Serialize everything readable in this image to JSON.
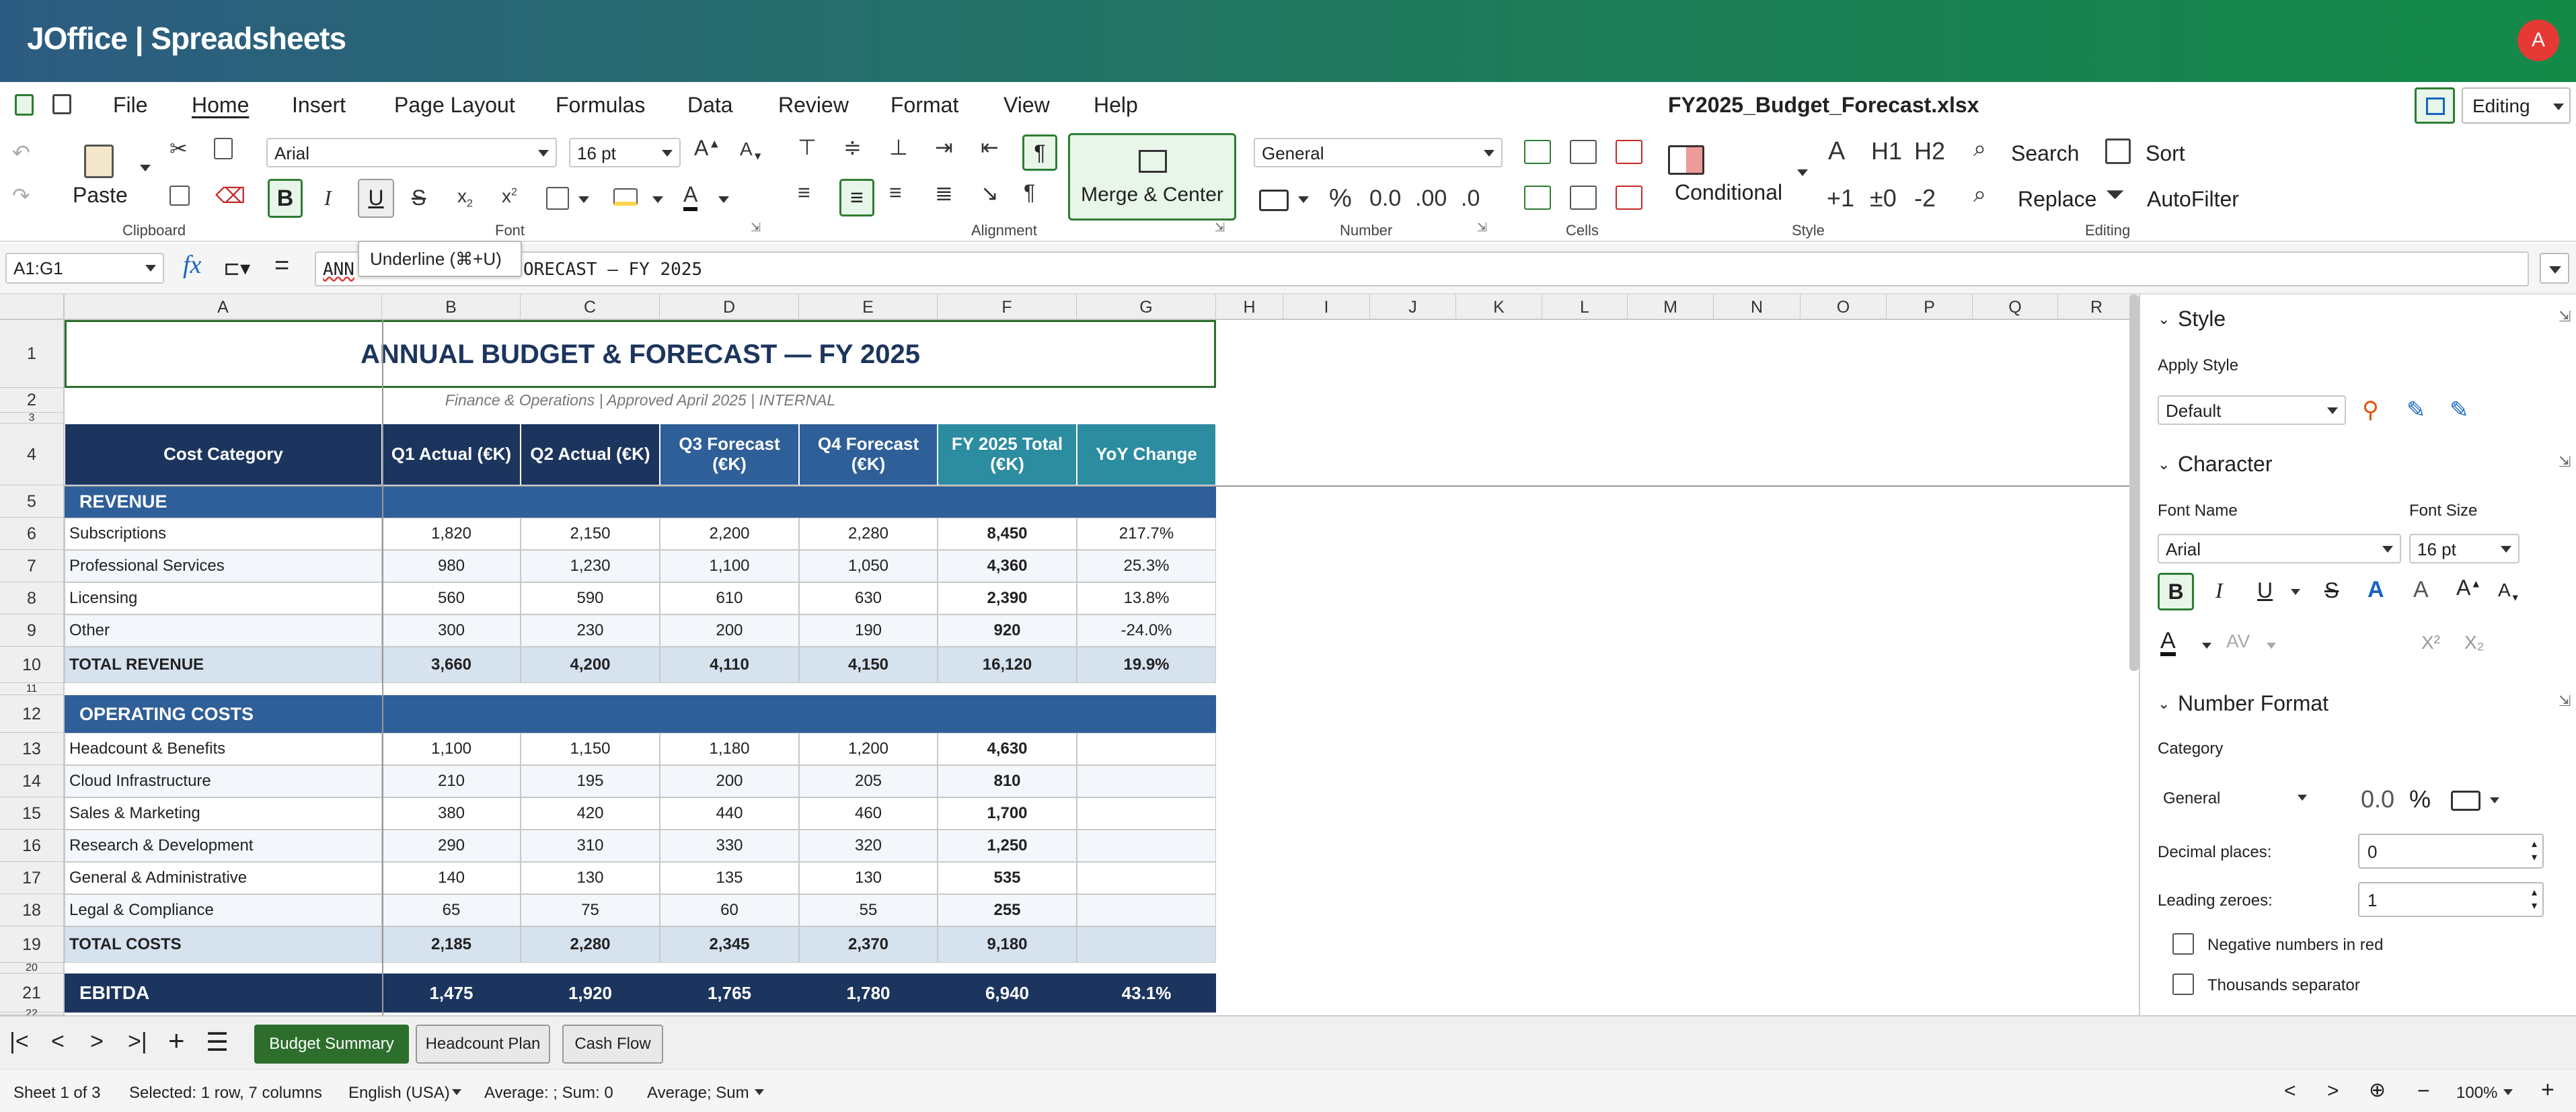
{
  "app": {
    "title": "JOffice | Spreadsheets",
    "avatar_letter": "A"
  },
  "menu": {
    "items": [
      "File",
      "Home",
      "Insert",
      "Page Layout",
      "Formulas",
      "Data",
      "Review",
      "Format",
      "View",
      "Help"
    ],
    "active": "Home",
    "doc_title": "FY2025_Budget_Forecast.xlsx",
    "mode": "Editing"
  },
  "ribbon": {
    "paste": "Paste",
    "font_name": "Arial",
    "font_size": "16 pt",
    "merge_center": "Merge & Center",
    "number_format": "General",
    "percent": "%",
    "decimals_a": "0.0",
    "decimals_b": ".00",
    "decimals_c": ".0",
    "conditional": "Conditional",
    "style_a": "A",
    "style_h1": "H1",
    "style_h2": "H2",
    "style_p1": "+1",
    "style_0": "±0",
    "style_m2": "-2",
    "search": "Search",
    "sort": "Sort",
    "replace": "Replace",
    "autofilter": "AutoFilter",
    "groups": {
      "clipboard": "Clipboard",
      "font": "Font",
      "alignment": "Alignment",
      "number": "Number",
      "cells": "Cells",
      "style": "Style",
      "editing": "Editing"
    }
  },
  "formula_bar": {
    "name_box": "A1:G1",
    "formula_start": "ANN",
    "formula_end": "ORECAST — FY 2025",
    "tooltip": "Underline (⌘+U)"
  },
  "columns": [
    "A",
    "B",
    "C",
    "D",
    "E",
    "F",
    "G",
    "H",
    "I",
    "J",
    "K",
    "L",
    "M",
    "N",
    "O",
    "P",
    "Q",
    "R"
  ],
  "rows": [
    "1",
    "2",
    "3",
    "4",
    "5",
    "6",
    "7",
    "8",
    "9",
    "10",
    "11",
    "12",
    "13",
    "14",
    "15",
    "16",
    "17",
    "18",
    "19",
    "20",
    "21",
    "22"
  ],
  "sheet": {
    "title": "ANNUAL BUDGET & FORECAST — FY 2025",
    "subtitle": "Finance & Operations  |  Approved April 2025  |  INTERNAL",
    "headers": [
      "Cost Category",
      "Q1 Actual (€K)",
      "Q2 Actual (€K)",
      "Q3 Forecast (€K)",
      "Q4 Forecast (€K)",
      "FY 2025 Total (€K)",
      "YoY Change"
    ],
    "revenue_section": "REVENUE",
    "revenue_rows": [
      [
        "Subscriptions",
        "1,820",
        "2,150",
        "2,200",
        "2,280",
        "8,450",
        "217.7%"
      ],
      [
        "Professional Services",
        "980",
        "1,230",
        "1,100",
        "1,050",
        "4,360",
        "25.3%"
      ],
      [
        "Licensing",
        "560",
        "590",
        "610",
        "630",
        "2,390",
        "13.8%"
      ],
      [
        "Other",
        "300",
        "230",
        "200",
        "190",
        "920",
        "-24.0%"
      ]
    ],
    "total_revenue": [
      "TOTAL REVENUE",
      "3,660",
      "4,200",
      "4,110",
      "4,150",
      "16,120",
      "19.9%"
    ],
    "costs_section": "OPERATING COSTS",
    "cost_rows": [
      [
        "Headcount & Benefits",
        "1,100",
        "1,150",
        "1,180",
        "1,200",
        "4,630",
        ""
      ],
      [
        "Cloud Infrastructure",
        "210",
        "195",
        "200",
        "205",
        "810",
        ""
      ],
      [
        "Sales & Marketing",
        "380",
        "420",
        "440",
        "460",
        "1,700",
        ""
      ],
      [
        "Research & Development",
        "290",
        "310",
        "330",
        "320",
        "1,250",
        ""
      ],
      [
        "General & Administrative",
        "140",
        "130",
        "135",
        "130",
        "535",
        ""
      ],
      [
        "Legal & Compliance",
        "65",
        "75",
        "60",
        "55",
        "255",
        ""
      ]
    ],
    "total_costs": [
      "TOTAL COSTS",
      "2,185",
      "2,280",
      "2,345",
      "2,370",
      "9,180",
      ""
    ],
    "ebitda": [
      "EBITDA",
      "1,475",
      "1,920",
      "1,765",
      "1,780",
      "6,940",
      "43.1%"
    ]
  },
  "sidebar": {
    "style": {
      "title": "Style",
      "apply_label": "Apply Style",
      "value": "Default"
    },
    "character": {
      "title": "Character",
      "font_name_label": "Font Name",
      "font_size_label": "Font Size",
      "font_name": "Arial",
      "font_size": "16 pt",
      "sup": "X²",
      "sub": "X₂",
      "av": "AV"
    },
    "number_format": {
      "title": "Number Format",
      "category_label": "Category",
      "category": "General",
      "decimals_label": "Decimal places:",
      "decimals": "0",
      "leading_label": "Leading zeroes:",
      "leading": "1",
      "negative_red": "Negative numbers in red",
      "thousands_sep": "Thousands separator",
      "dec_icon": "0.0",
      "pct_icon": "%"
    }
  },
  "tabs": [
    "Budget Summary",
    "Headcount Plan",
    "Cash Flow"
  ],
  "status": {
    "sheet": "Sheet 1 of 3",
    "selection": "Selected: 1 row, 7 columns",
    "language": "English (USA)",
    "avg_sum": "Average: ; Sum: 0",
    "agg_mode": "Average; Sum",
    "zoom": "100%"
  },
  "colors": {
    "navy": "#1c355e",
    "blue": "#2f5f98",
    "teal": "#2c8ca0",
    "total_bg": "#d6e2ee",
    "accent_green": "#2d6e2d"
  }
}
